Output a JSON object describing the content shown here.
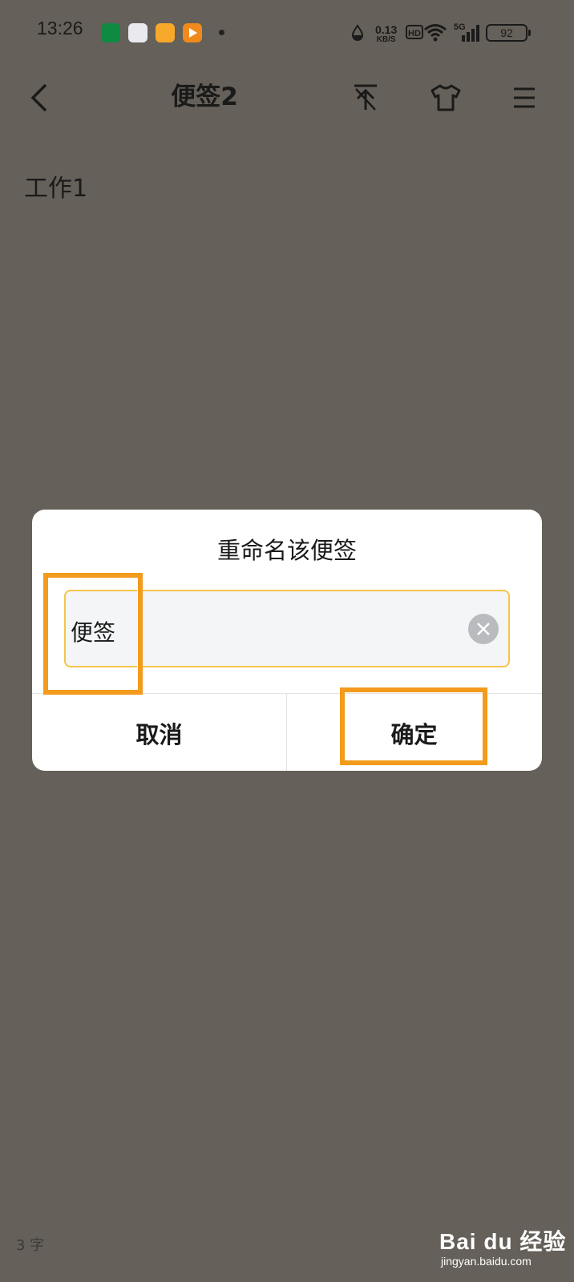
{
  "status_bar": {
    "time": "13:26",
    "net_speed_value": "0.13",
    "net_speed_unit": "KB/S",
    "hd": "HD",
    "network_type": "5G",
    "battery": "92"
  },
  "toolbar": {
    "title": "便签2"
  },
  "note": {
    "content": "工作1",
    "char_count": "3 字"
  },
  "dialog": {
    "title": "重命名该便签",
    "input_value": "便签",
    "cancel_label": "取消",
    "confirm_label": "确定"
  },
  "watermark": {
    "main": "Bai du 经验",
    "sub": "jingyan.baidu.com"
  },
  "colors": {
    "overlay_bg": "#656059",
    "highlight": "#f29b1c",
    "input_border": "#f4c54a"
  }
}
